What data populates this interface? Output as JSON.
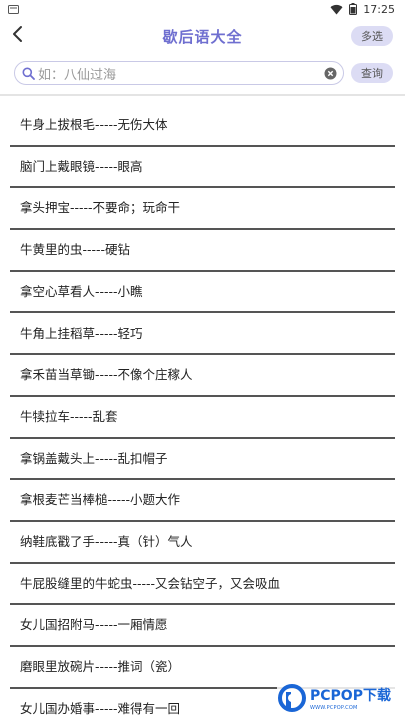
{
  "status_bar": {
    "time": "17:25",
    "icons": [
      "notification-icon",
      "wifi-icon",
      "battery-icon"
    ]
  },
  "nav": {
    "back_icon": "back-arrow-icon",
    "title": "歇后语大全",
    "multi_select_label": "多选"
  },
  "search": {
    "placeholder": "如：八仙过海",
    "search_icon": "search-icon",
    "clear_icon": "clear-icon",
    "query_label": "查询"
  },
  "list": {
    "items": [
      "牛身上拔根毛-----无伤大体",
      "脑门上戴眼镜-----眼高",
      "拿头押宝-----不要命；玩命干",
      "牛黄里的虫-----硬钻",
      "拿空心草看人-----小瞧",
      "牛角上挂稻草-----轻巧",
      "拿禾苗当草锄-----不像个庄稼人",
      "牛犊拉车-----乱套",
      "拿锅盖戴头上-----乱扣帽子",
      "拿根麦芒当棒槌-----小题大作",
      "纳鞋底戳了手-----真（针）气人",
      "牛屁股缝里的牛蛇虫-----又会钻空子，又会吸血",
      "女儿国招附马-----一厢情愿",
      "磨眼里放碗片-----推词（瓷）",
      "女儿国办婚事-----难得有一回"
    ]
  },
  "watermark": {
    "text": "PCPOP下载",
    "subtext": "WWW.PCPOP.COM",
    "color": "#1a66d6"
  },
  "colors": {
    "accent": "#6f6fd0",
    "pill_bg": "#dcdcf4",
    "divider": "#555555"
  }
}
